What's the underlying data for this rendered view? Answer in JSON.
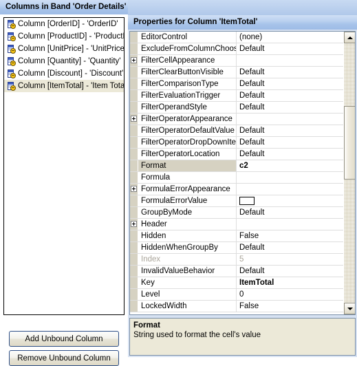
{
  "left": {
    "title": "Columns in Band 'Order Details'",
    "tree_items": [
      {
        "label": "Column [OrderID] - 'OrderID'",
        "icon": "column-icon",
        "selected": false
      },
      {
        "label": "Column [ProductID] - 'ProductID'",
        "icon": "column-icon",
        "selected": false
      },
      {
        "label": "Column [UnitPrice] - 'UnitPrice'",
        "icon": "column-icon",
        "selected": false
      },
      {
        "label": "Column [Quantity] - 'Quantity'",
        "icon": "column-icon",
        "selected": false
      },
      {
        "label": "Column [Discount] - 'Discount'",
        "icon": "column-icon",
        "selected": false
      },
      {
        "label": "Column [ItemTotal] - 'Item Total'",
        "icon": "column-icon",
        "selected": true
      }
    ],
    "add_button_label": "Add Unbound Column",
    "remove_button_label": "Remove Unbound Column"
  },
  "right": {
    "title": "Properties for Column 'ItemTotal'",
    "rows": [
      {
        "name": "EditorControl",
        "value": "(none)",
        "expandable": false,
        "selected": false,
        "disabled": false,
        "bold": false,
        "swatch": false
      },
      {
        "name": "ExcludeFromColumnChooser",
        "value": "Default",
        "expandable": false,
        "selected": false,
        "disabled": false,
        "bold": false,
        "swatch": false
      },
      {
        "name": "FilterCellAppearance",
        "value": "",
        "expandable": true,
        "selected": false,
        "disabled": false,
        "bold": false,
        "swatch": false
      },
      {
        "name": "FilterClearButtonVisible",
        "value": "Default",
        "expandable": false,
        "selected": false,
        "disabled": false,
        "bold": false,
        "swatch": false
      },
      {
        "name": "FilterComparisonType",
        "value": "Default",
        "expandable": false,
        "selected": false,
        "disabled": false,
        "bold": false,
        "swatch": false
      },
      {
        "name": "FilterEvaluationTrigger",
        "value": "Default",
        "expandable": false,
        "selected": false,
        "disabled": false,
        "bold": false,
        "swatch": false
      },
      {
        "name": "FilterOperandStyle",
        "value": "Default",
        "expandable": false,
        "selected": false,
        "disabled": false,
        "bold": false,
        "swatch": false
      },
      {
        "name": "FilterOperatorAppearance",
        "value": "",
        "expandable": true,
        "selected": false,
        "disabled": false,
        "bold": false,
        "swatch": false
      },
      {
        "name": "FilterOperatorDefaultValue",
        "value": "Default",
        "expandable": false,
        "selected": false,
        "disabled": false,
        "bold": false,
        "swatch": false
      },
      {
        "name": "FilterOperatorDropDownItems",
        "value": "Default",
        "expandable": false,
        "selected": false,
        "disabled": false,
        "bold": false,
        "swatch": false
      },
      {
        "name": "FilterOperatorLocation",
        "value": "Default",
        "expandable": false,
        "selected": false,
        "disabled": false,
        "bold": false,
        "swatch": false
      },
      {
        "name": "Format",
        "value": "c2",
        "expandable": false,
        "selected": true,
        "disabled": false,
        "bold": true,
        "swatch": false
      },
      {
        "name": "Formula",
        "value": "",
        "expandable": false,
        "selected": false,
        "disabled": false,
        "bold": false,
        "swatch": false
      },
      {
        "name": "FormulaErrorAppearance",
        "value": "",
        "expandable": true,
        "selected": false,
        "disabled": false,
        "bold": false,
        "swatch": false
      },
      {
        "name": "FormulaErrorValue",
        "value": "",
        "expandable": false,
        "selected": false,
        "disabled": false,
        "bold": false,
        "swatch": true
      },
      {
        "name": "GroupByMode",
        "value": "Default",
        "expandable": false,
        "selected": false,
        "disabled": false,
        "bold": false,
        "swatch": false
      },
      {
        "name": "Header",
        "value": "",
        "expandable": true,
        "selected": false,
        "disabled": false,
        "bold": false,
        "swatch": false
      },
      {
        "name": "Hidden",
        "value": "False",
        "expandable": false,
        "selected": false,
        "disabled": false,
        "bold": false,
        "swatch": false
      },
      {
        "name": "HiddenWhenGroupBy",
        "value": "Default",
        "expandable": false,
        "selected": false,
        "disabled": false,
        "bold": false,
        "swatch": false
      },
      {
        "name": "Index",
        "value": "5",
        "expandable": false,
        "selected": false,
        "disabled": true,
        "bold": false,
        "swatch": false
      },
      {
        "name": "InvalidValueBehavior",
        "value": "Default",
        "expandable": false,
        "selected": false,
        "disabled": false,
        "bold": false,
        "swatch": false
      },
      {
        "name": "Key",
        "value": "ItemTotal",
        "expandable": false,
        "selected": false,
        "disabled": false,
        "bold": true,
        "swatch": false
      },
      {
        "name": "Level",
        "value": "0",
        "expandable": false,
        "selected": false,
        "disabled": false,
        "bold": false,
        "swatch": false
      },
      {
        "name": "LockedWidth",
        "value": "False",
        "expandable": false,
        "selected": false,
        "disabled": false,
        "bold": false,
        "swatch": false
      }
    ],
    "scrollbar": {
      "up_icon": "scroll-up-arrow-icon",
      "down_icon": "scroll-down-arrow-icon"
    },
    "description": {
      "title": "Format",
      "text": "String used to format the cell's value"
    }
  },
  "colors": {
    "title_gradient_top": "#cfdff5",
    "title_gradient_bottom": "#9dbbe6",
    "selection_highlight": "#ece9d8",
    "grid_row_selected": "#d6d2c2",
    "panel_background": "#d7e2f2",
    "description_background": "#ece9d8",
    "button_border": "#2d4e86"
  }
}
